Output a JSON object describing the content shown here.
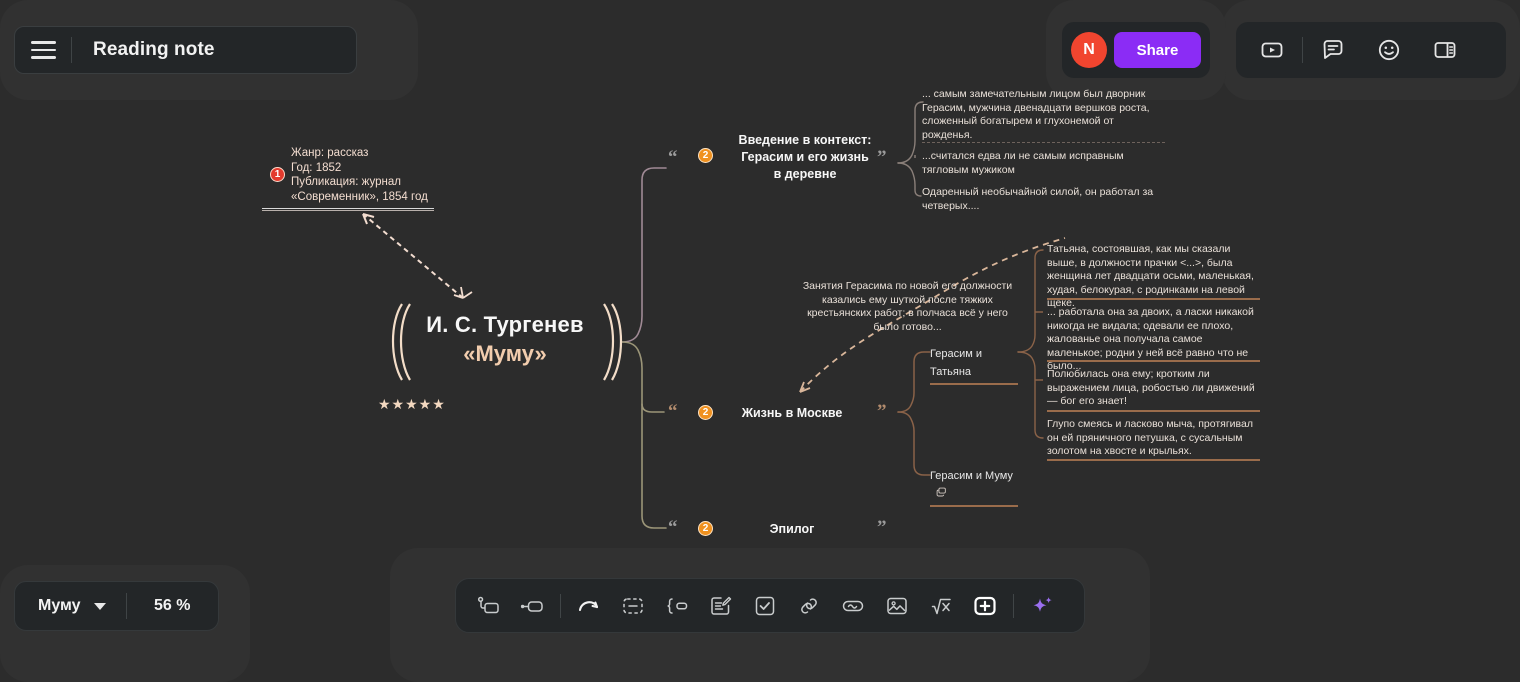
{
  "header": {
    "note_title": "Reading note",
    "menu_icon": "hamburger-icon",
    "avatar_initial": "N",
    "share_label": "Share",
    "icons": [
      {
        "name": "video-play-icon"
      },
      {
        "name": "comment-icon"
      },
      {
        "name": "emoji-icon"
      },
      {
        "name": "panel-layout-icon"
      }
    ]
  },
  "mindmap": {
    "meta_note": {
      "badge": "1",
      "line1": "Жанр: рассказ",
      "line2": "Год: 1852",
      "line3": "Публикация: журнал",
      "line4": "«Современник», 1854 год"
    },
    "center": {
      "author": "И. С. Тургенев",
      "work": "«Муму»",
      "rating": "★★★★★"
    },
    "branches": [
      {
        "badge": "2",
        "label_line1": "Введение в контекст:",
        "label_line2": "Герасим и его жизнь",
        "label_line3": "в деревне",
        "quote_open": "“",
        "quote_close": "”",
        "quotes": [
          "... самым замечательным лицом был дворник Герасим, мужчина двенадцати вершков роста, сложенный богатырем и глухонемой от рожденья.",
          "...считался едва ли не самым исправным тягловым мужиком",
          "Одаренный необычайной силой, он работал за четверых...."
        ]
      },
      {
        "badge": "2",
        "label_line1": "Жизнь в Москве",
        "quote_open": "“",
        "quote_close": "”",
        "floating_note": "Занятия Герасима по новой его должности казались ему шуткой после тяжких крестьянских работ; в полчаса всё у него было готово...",
        "subnodes": [
          {
            "label": "Герасим и Татьяна",
            "icon": "",
            "quotes": [
              "Татьяна, состоявшая, как мы сказали выше, в должности прачки <...>, была женщина лет двадцати осьми, маленькая, худая, белокурая, с родинками на левой щеке.",
              "... работала она за двоих, а ласки никакой никогда не видала; одевали ее плохо, жалованье она получала самое маленькое; родни у ней всё равно что не было...",
              "Полюбилась она ему; кротким ли выражением лица, робостью ли движений — бог его знает!",
              "Глупо смеясь и ласково мыча, протягивал он ей пряничного петушка, с сусальным золотом на хвосте и крыльях."
            ]
          },
          {
            "label": "Герасим и Муму",
            "icon": "copy-layers-icon",
            "quotes": []
          }
        ]
      },
      {
        "badge": "2",
        "label_line1": "Эпилог",
        "quote_open": "“",
        "quote_close": "”",
        "quotes": []
      }
    ]
  },
  "footer": {
    "sheet_name": "Муму",
    "sheet_caret": "chevron-down-icon",
    "zoom_level": "56 %",
    "tools": [
      {
        "name": "subtopic-tool"
      },
      {
        "name": "sibling-topic-tool"
      },
      {
        "name": "relationship-tool"
      },
      {
        "name": "boundary-tool"
      },
      {
        "name": "summary-tool"
      },
      {
        "name": "note-tool"
      },
      {
        "name": "task-checkbox-tool"
      },
      {
        "name": "hyperlink-tool"
      },
      {
        "name": "sticker-tool"
      },
      {
        "name": "image-tool"
      },
      {
        "name": "equation-tool"
      },
      {
        "name": "add-tool"
      },
      {
        "name": "ai-sparkle-tool"
      }
    ]
  },
  "colors": {
    "background": "#2c2c2c",
    "accent_purple": "#8b2cf5",
    "avatar_red": "#f1452f",
    "badge_orange": "#f0911f",
    "badge_red": "#e33b2e",
    "branch_brown": "#9a6c4b",
    "title_peach": "#f2cdae"
  }
}
